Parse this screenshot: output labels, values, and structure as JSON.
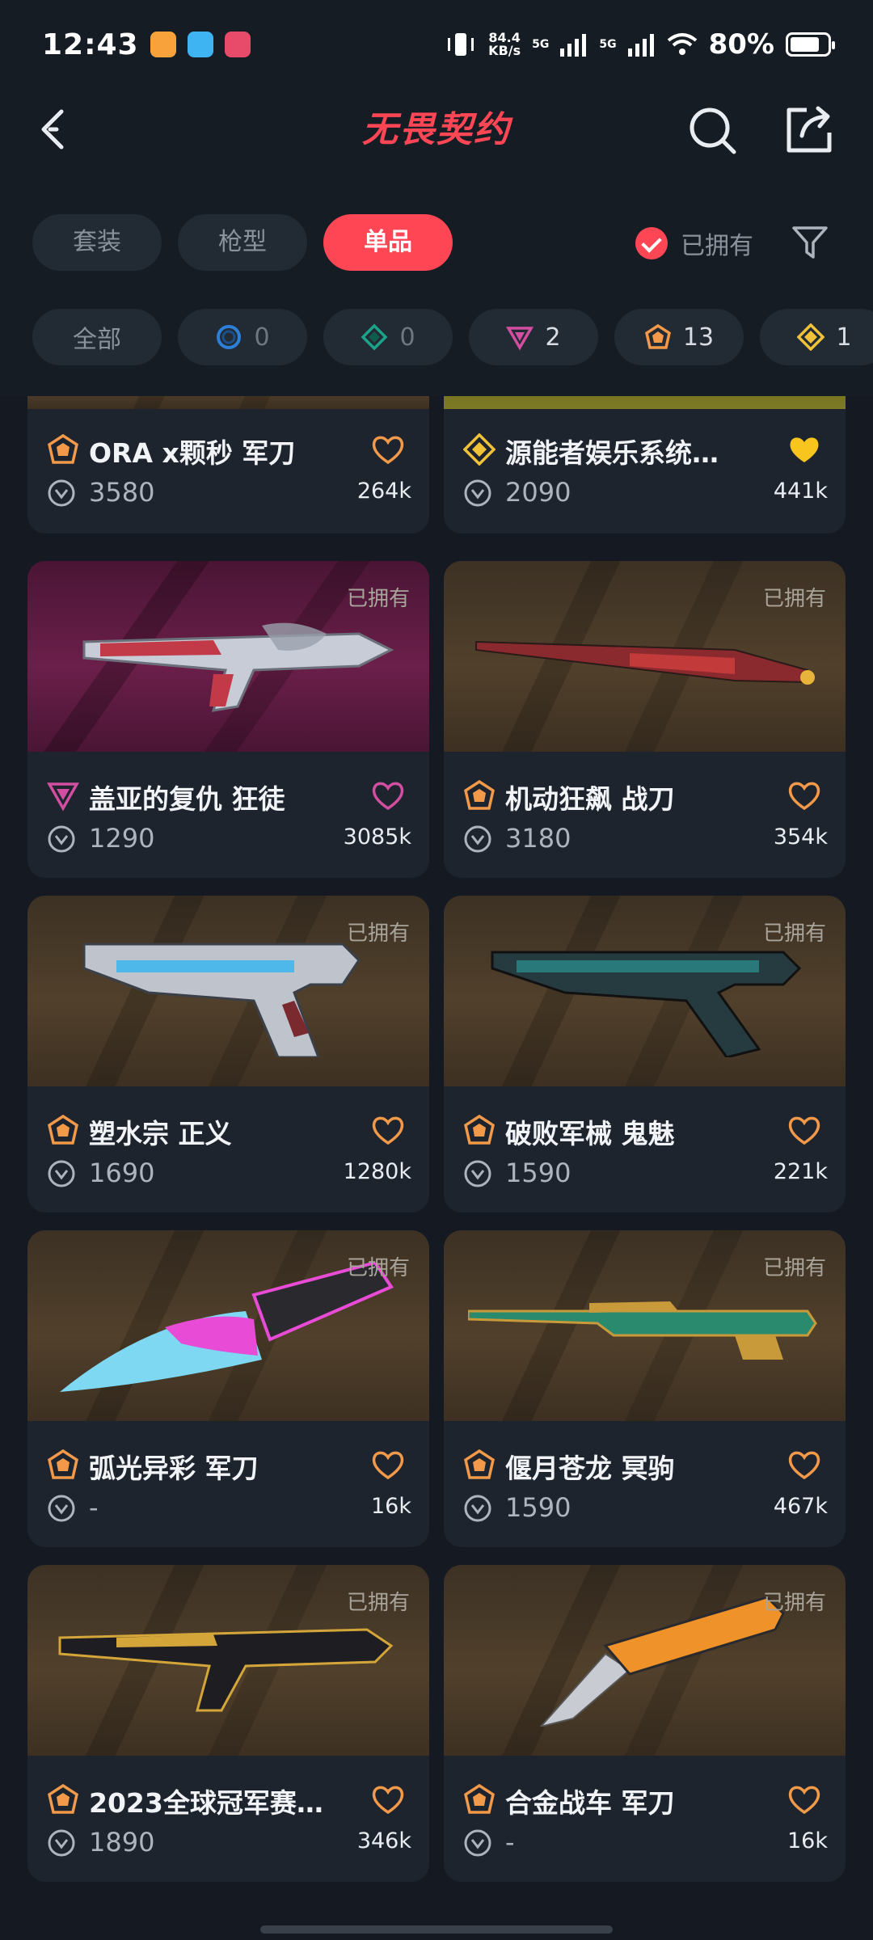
{
  "status_bar": {
    "time": "12:43",
    "net_speed_value": "84.4",
    "net_speed_unit": "KB/s",
    "sim1": "5G",
    "sim2": "5G",
    "battery_pct": "80%",
    "battery_level": 0.8
  },
  "header": {
    "logo_text": "无畏契约"
  },
  "tabs": [
    {
      "label": "套装",
      "active": false
    },
    {
      "label": "枪型",
      "active": false
    },
    {
      "label": "单品",
      "active": true
    }
  ],
  "owned_filter": {
    "label": "已拥有",
    "checked": true
  },
  "tier_chips": [
    {
      "label": "全部",
      "icon": "none"
    },
    {
      "label": "0",
      "icon": "select-tier-icon",
      "color": "#2b7fd6"
    },
    {
      "label": "0",
      "icon": "deluxe-tier-icon",
      "color": "#1aa38a"
    },
    {
      "label": "2",
      "icon": "premium-tier-icon",
      "color": "#d14ea0"
    },
    {
      "label": "13",
      "icon": "exclusive-tier-icon",
      "color": "#f2994a"
    },
    {
      "label": "1",
      "icon": "ultra-tier-icon",
      "color": "#f0c23a"
    }
  ],
  "colors": {
    "accent": "#ff4655",
    "heart_outline": "#f2994a",
    "heart_filled": "#f7c51e",
    "premium": "#d14ea0",
    "exclusive": "#f2994a",
    "ultra": "#f0c23a"
  },
  "items": [
    {
      "name": "ORA x颗秒 军刀",
      "price": "3580",
      "likes": "264k",
      "owned": "",
      "tier": "exclusive",
      "heart": "outline"
    },
    {
      "name": "源能者娱乐系统…",
      "price": "2090",
      "likes": "441k",
      "owned": "",
      "tier": "ultra",
      "heart": "filled"
    },
    {
      "name": "盖亚的复仇 狂徒",
      "price": "1290",
      "likes": "3085k",
      "owned": "已拥有",
      "tier": "premium",
      "heart": "pink"
    },
    {
      "name": "机动狂飙 战刀",
      "price": "3180",
      "likes": "354k",
      "owned": "已拥有",
      "tier": "exclusive",
      "heart": "outline"
    },
    {
      "name": "塑水宗 正义",
      "price": "1690",
      "likes": "1280k",
      "owned": "已拥有",
      "tier": "exclusive",
      "heart": "outline"
    },
    {
      "name": "破败军械 鬼魅",
      "price": "1590",
      "likes": "221k",
      "owned": "已拥有",
      "tier": "exclusive",
      "heart": "outline"
    },
    {
      "name": "弧光异彩 军刀",
      "price": "-",
      "likes": "16k",
      "owned": "已拥有",
      "tier": "exclusive",
      "heart": "outline"
    },
    {
      "name": "偃月苍龙 冥驹",
      "price": "1590",
      "likes": "467k",
      "owned": "已拥有",
      "tier": "exclusive",
      "heart": "outline"
    },
    {
      "name": "2023全球冠军赛…",
      "price": "1890",
      "likes": "346k",
      "owned": "已拥有",
      "tier": "exclusive",
      "heart": "outline"
    },
    {
      "name": "合金战车 军刀",
      "price": "-",
      "likes": "16k",
      "owned": "已拥有",
      "tier": "exclusive",
      "heart": "outline"
    }
  ]
}
